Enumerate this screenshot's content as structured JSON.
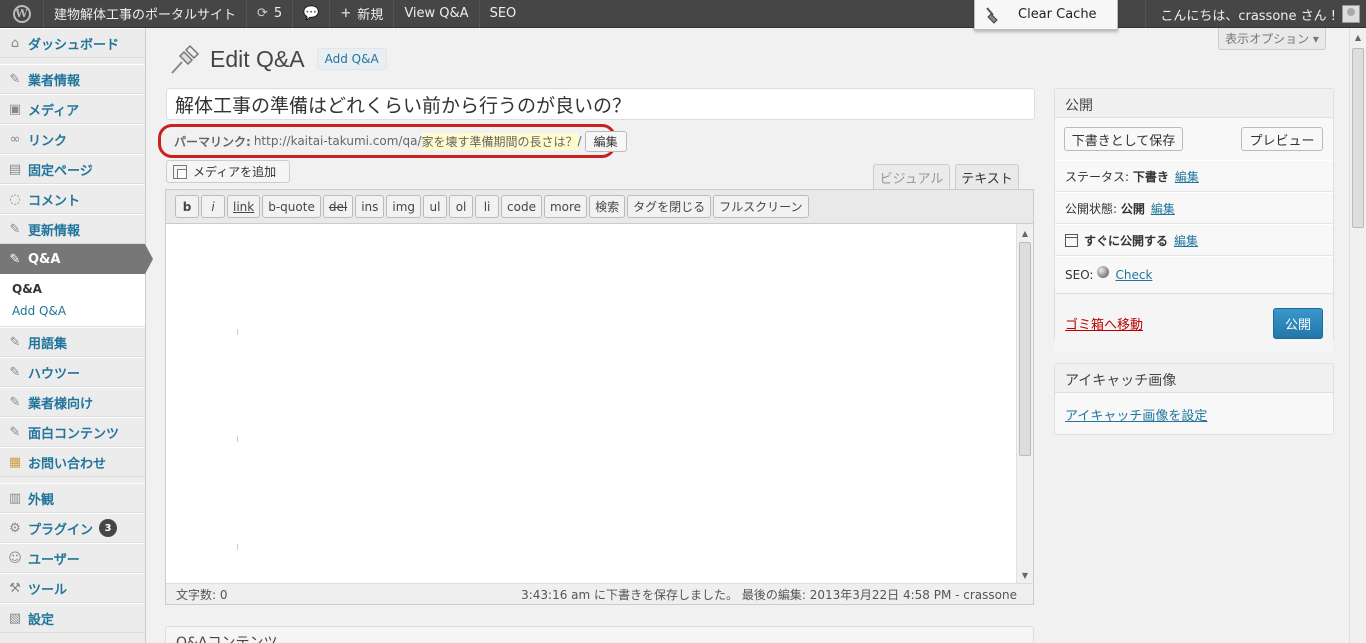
{
  "adminbar": {
    "site_name": "建物解体工事のポータルサイト",
    "updates_count": "5",
    "new_label": "新規",
    "view_label": "View Q&A",
    "seo_label": "SEO",
    "clear_cache_label": "Clear Cache",
    "greeting": "こんにちは、crassone さん !"
  },
  "sidebar": {
    "items": [
      {
        "label": "ダッシュボード",
        "icon": "dashboard-icon"
      },
      {
        "label": "業者情報",
        "icon": "pin-icon"
      },
      {
        "label": "メディア",
        "icon": "media-icon"
      },
      {
        "label": "リンク",
        "icon": "link-icon"
      },
      {
        "label": "固定ページ",
        "icon": "page-icon"
      },
      {
        "label": "コメント",
        "icon": "comment-icon"
      },
      {
        "label": "更新情報",
        "icon": "pin-icon"
      },
      {
        "label": "Q&A",
        "icon": "pin-icon"
      },
      {
        "label": "用語集",
        "icon": "pin-icon"
      },
      {
        "label": "ハウツー",
        "icon": "pin-icon"
      },
      {
        "label": "業者様向け",
        "icon": "pin-icon"
      },
      {
        "label": "面白コンテンツ",
        "icon": "pin-icon"
      },
      {
        "label": "お問い合わせ",
        "icon": "form-icon"
      },
      {
        "label": "外観",
        "icon": "appearance-icon"
      },
      {
        "label": "プラグイン",
        "icon": "plugin-icon",
        "badge": "3"
      },
      {
        "label": "ユーザー",
        "icon": "users-icon"
      },
      {
        "label": "ツール",
        "icon": "tools-icon"
      },
      {
        "label": "設定",
        "icon": "settings-icon"
      }
    ],
    "submenu": {
      "current": "Q&A",
      "other": "Add Q&A"
    }
  },
  "screen_options": "表示オプション ▾",
  "page": {
    "title": "Edit Q&A",
    "add_new": "Add Q&A",
    "post_title": "解体工事の準備はどれくらい前から行うのが良いの？"
  },
  "permalink": {
    "label": "パーマリンク:",
    "base": "http://kaitai-takumi.com/qa/",
    "slug": "家を壊す準備期間の長さは？",
    "suffix": "/",
    "edit_label": "編集"
  },
  "editor": {
    "add_media": "メディアを追加",
    "tab_visual": "ビジュアル",
    "tab_text": "テキスト",
    "buttons": [
      "b",
      "i",
      "link",
      "b-quote",
      "del",
      "ins",
      "img",
      "ul",
      "ol",
      "li",
      "code",
      "more",
      "検索",
      "タグを閉じる",
      "フルスクリーン"
    ],
    "word_count": "文字数: 0",
    "autosave": "3:43:16 am に下書きを保存しました。 最後の編集: 2013年3月22日 4:58 PM - crassone"
  },
  "publish": {
    "heading": "公開",
    "save_draft": "下書きとして保存",
    "preview": "プレビュー",
    "status_label": "ステータス:",
    "status_value": "下書き",
    "visibility_label": "公開状態:",
    "visibility_value": "公開",
    "schedule_value": "すぐに公開する",
    "edit_link": "編集",
    "seo_label": "SEO:",
    "seo_check": "Check",
    "trash": "ゴミ箱へ移動",
    "publish_btn": "公開"
  },
  "thumbnail": {
    "heading": "アイキャッチ画像",
    "set_link": "アイキャッチ画像を設定"
  },
  "qa_contents_heading": "Q&Aコンテンツ"
}
